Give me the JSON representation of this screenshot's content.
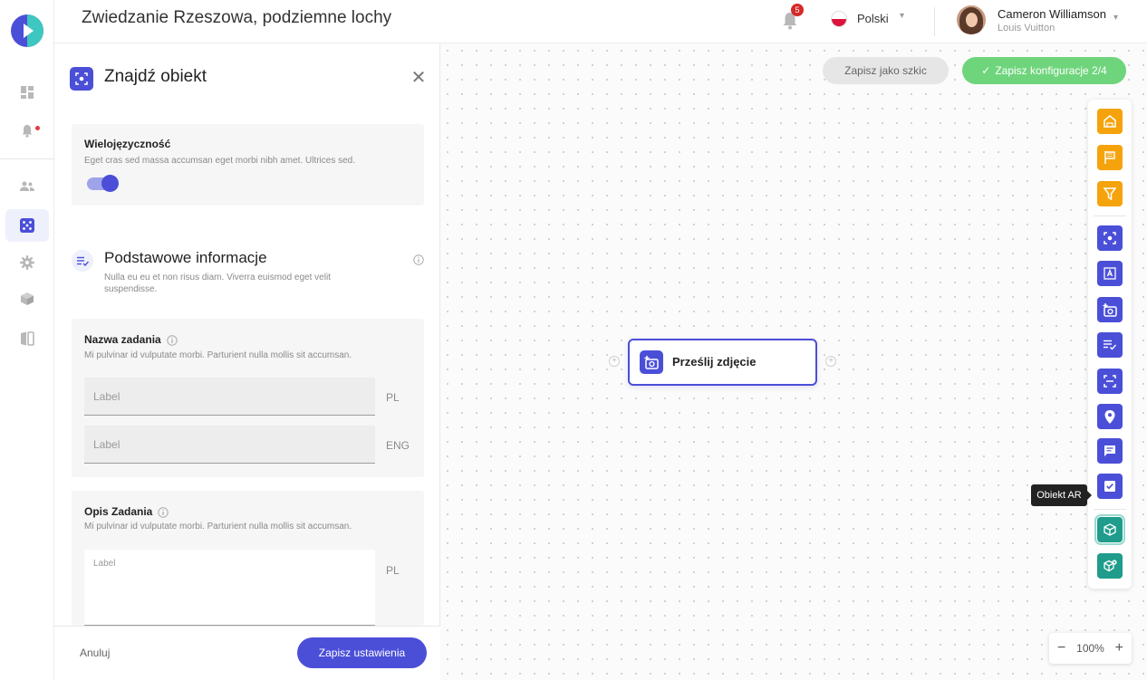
{
  "header": {
    "title": "Zwiedzanie Rzeszowa, podziemne lochy",
    "notifications_count": "5",
    "language": "Polski",
    "user_name": "Cameron Williamson",
    "user_org": "Louis Vuitton"
  },
  "sidebar": {
    "items": [
      {
        "icon": "dashboard-icon",
        "active": false
      },
      {
        "icon": "bell-icon",
        "active": false,
        "dot": true
      },
      {
        "icon": "users-icon",
        "active": false
      },
      {
        "icon": "dice-icon",
        "active": true
      },
      {
        "icon": "gear-icon",
        "active": false
      },
      {
        "icon": "box-icon",
        "active": false
      },
      {
        "icon": "book-icon",
        "active": false
      }
    ]
  },
  "panel": {
    "title": "Znajdź obiekt",
    "multilang": {
      "title": "Wielojęzyczność",
      "desc": "Eget cras sed massa accumsan eget morbi nibh amet. Ultrices sed.",
      "enabled": true
    },
    "basic": {
      "title": "Podstawowe informacje",
      "desc": "Nulla eu eu et non risus diam. Viverra euismod eget velit suspendisse."
    },
    "task_name": {
      "title": "Nazwa zadania",
      "desc": "Mi pulvinar id vulputate morbi. Parturient nulla mollis sit accumsan.",
      "fields": [
        {
          "placeholder": "Label",
          "lang": "PL"
        },
        {
          "placeholder": "Label",
          "lang": "ENG"
        }
      ]
    },
    "task_desc": {
      "title": "Opis Zadania",
      "desc": "Mi pulvinar id vulputate morbi. Parturient nulla mollis sit accumsan.",
      "fields": [
        {
          "placeholder": "Label",
          "lang": "PL"
        }
      ]
    },
    "cancel_label": "Anuluj",
    "save_label": "Zapisz ustawienia"
  },
  "canvas": {
    "draft_label": "Zapisz jako szkic",
    "save_config_label": "Zapisz konfiguracje 2/4",
    "node_label": "Prześlij zdjęcie",
    "tooltip": "Obiekt AR",
    "zoom_level": "100%"
  },
  "colors": {
    "accent": "#4b4fd8",
    "success": "#6fd57c",
    "orange": "#f5a30c",
    "teal": "#1f9c8b"
  },
  "toolbox": [
    {
      "icon": "home-icon",
      "color": "orange"
    },
    {
      "icon": "flag-icon",
      "color": "orange"
    },
    {
      "icon": "filter-icon",
      "color": "orange"
    },
    {
      "icon": "find-object-icon",
      "color": "blue"
    },
    {
      "icon": "text-recognition-icon",
      "color": "blue"
    },
    {
      "icon": "add-photo-icon",
      "color": "blue"
    },
    {
      "icon": "checklist-icon",
      "color": "blue"
    },
    {
      "icon": "scan-icon",
      "color": "blue"
    },
    {
      "icon": "location-pin-icon",
      "color": "blue"
    },
    {
      "icon": "message-icon",
      "color": "blue"
    },
    {
      "icon": "checkbox-icon",
      "color": "blue"
    },
    {
      "icon": "ar-cube-icon",
      "color": "teal"
    },
    {
      "icon": "ar-cube-settings-icon",
      "color": "teal"
    }
  ]
}
